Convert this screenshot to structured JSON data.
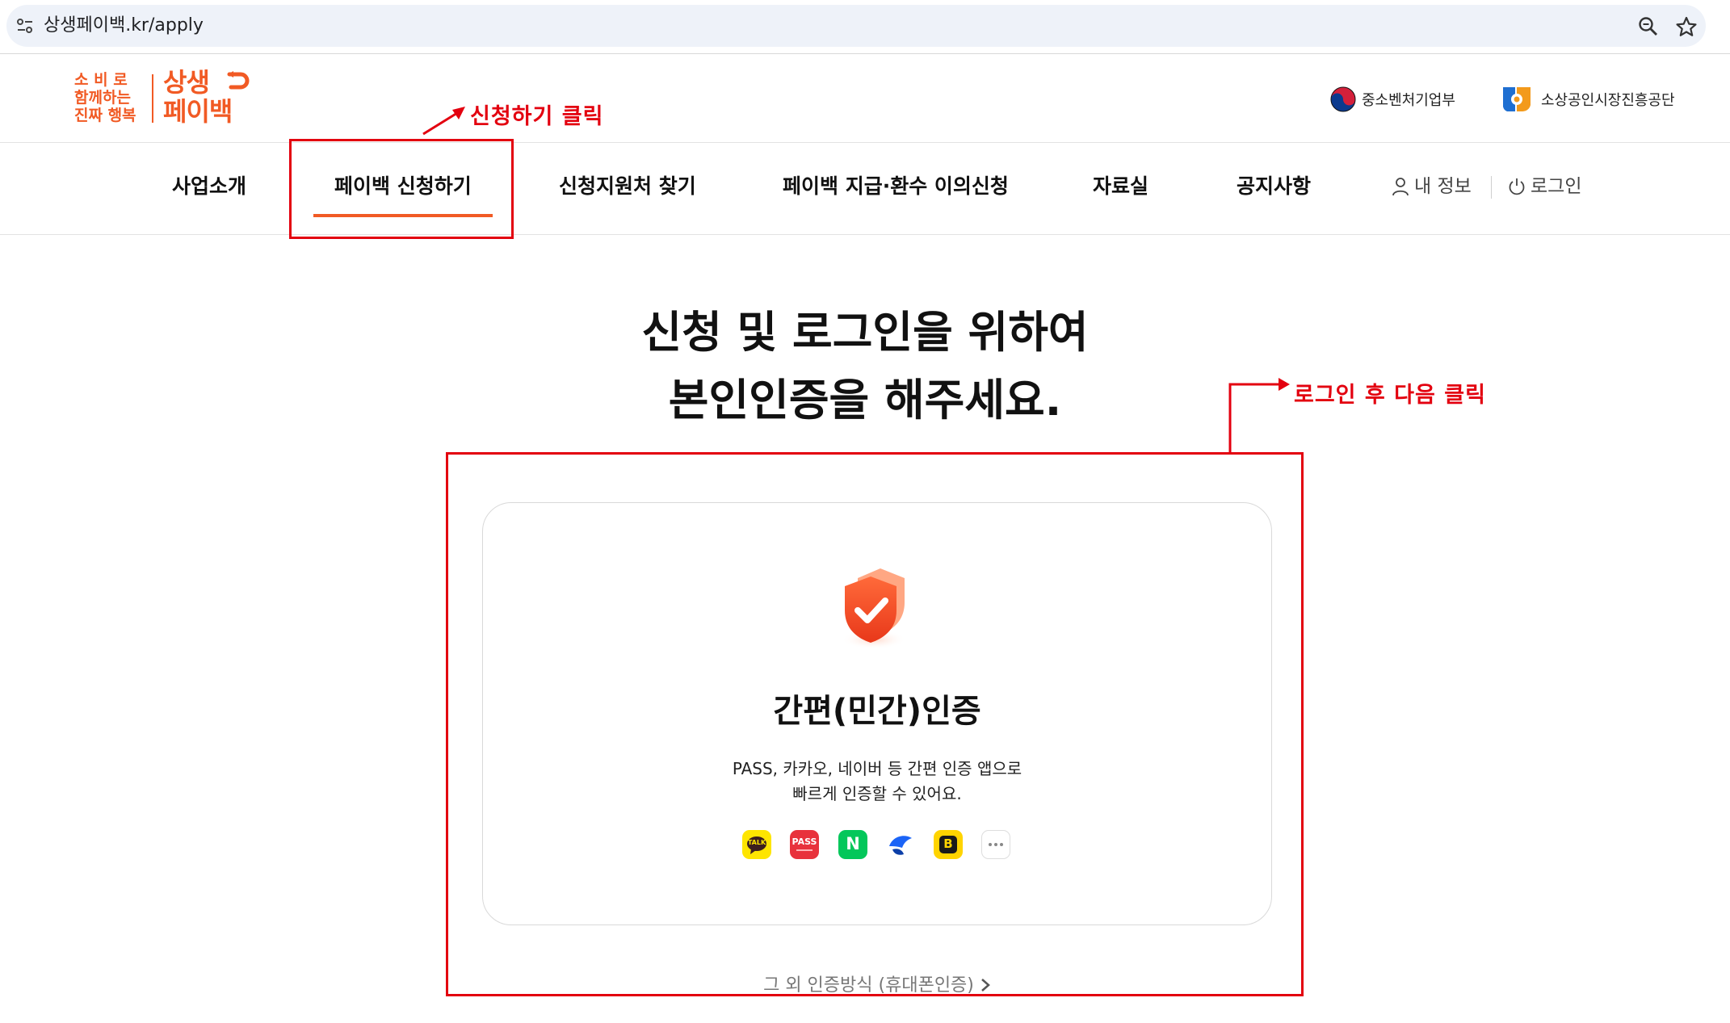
{
  "browser": {
    "url": "상생페이백.kr/apply",
    "icons": [
      "site-info-icon",
      "zoom-icon",
      "bookmark-star-icon"
    ]
  },
  "logo": {
    "slogan": [
      "소 비 로",
      "함께하는",
      "진짜 행복"
    ],
    "brand": [
      "상생",
      "페이백"
    ]
  },
  "partners": {
    "ministry": "중소벤처기업부",
    "agency": "소상공인시장진흥공단"
  },
  "nav": {
    "items": [
      "사업소개",
      "페이백 신청하기",
      "신청지원처 찾기",
      "페이백 지급·환수 이의신청",
      "자료실",
      "공지사항"
    ],
    "my_info": "내 정보",
    "login": "로그인"
  },
  "main": {
    "heading_line1": "신청 및 로그인을 위하여",
    "heading_line2": "본인인증을 해주세요.",
    "card_title": "간편(민간)인증",
    "card_desc_line1": "PASS, 카카오, 네이버 등 간편 인증 앱으로",
    "card_desc_line2": "빠르게 인증할 수 있어요.",
    "providers": [
      "kakao-talk",
      "pass",
      "naver",
      "toss",
      "banksalad",
      "more"
    ],
    "provider_labels": {
      "kakao": "TALK",
      "pass": "PASS",
      "naver": "N",
      "banksalad": "B"
    },
    "other_method": "그 외 인증방식 (휴대폰인증)"
  },
  "annotations": {
    "click_apply": "신청하기 클릭",
    "login_next": "로그인 후 다음 클릭"
  },
  "colors": {
    "brand_orange": "#f15a24",
    "annotation_red": "#e3000f",
    "kakao_yellow": "#fee500",
    "pass_red": "#e8323c",
    "naver_green": "#03c75a",
    "toss_blue": "#1b64f7"
  }
}
